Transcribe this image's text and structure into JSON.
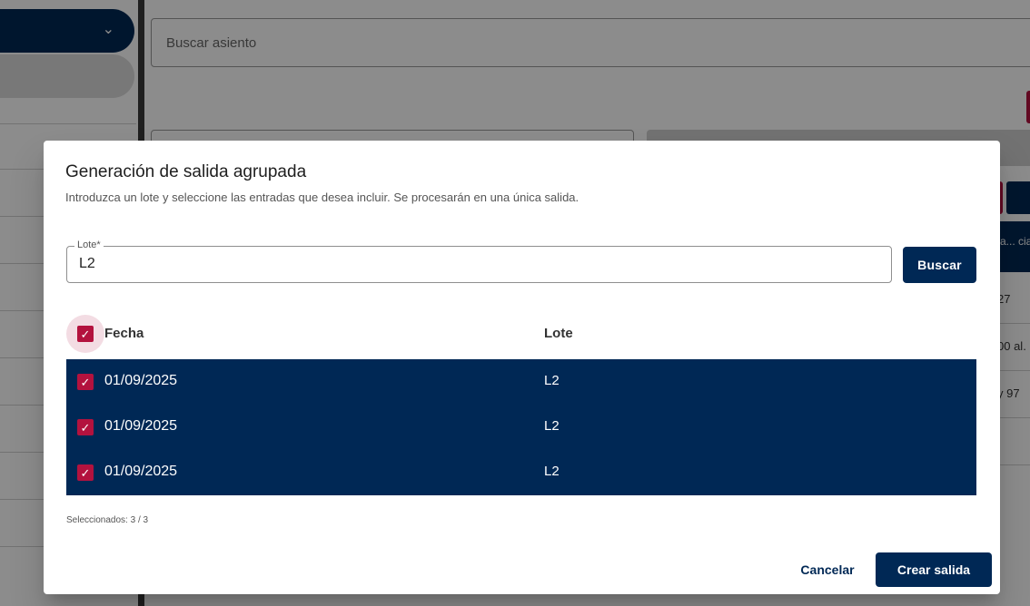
{
  "background": {
    "search_placeholder": "Buscar asiento",
    "table_header_partial": "a... cia",
    "cells_partial": [
      "27",
      "00 al.",
      "y 97"
    ]
  },
  "dialog": {
    "title": "Generación de salida agrupada",
    "subtitle": "Introduzca un lote y seleccione las entradas que desea incluir. Se procesarán en una única salida.",
    "lote_field": {
      "label": "Lote*",
      "value": "L2"
    },
    "search_button": "Buscar",
    "table": {
      "columns": [
        "Fecha",
        "Lote"
      ],
      "select_all_checked": true,
      "rows": [
        {
          "fecha": "01/09/2025",
          "lote": "L2",
          "checked": true
        },
        {
          "fecha": "01/09/2025",
          "lote": "L2",
          "checked": true
        },
        {
          "fecha": "01/09/2025",
          "lote": "L2",
          "checked": true
        }
      ]
    },
    "selected_counter": "Seleccionados: 3 / 3",
    "cancel_button": "Cancelar",
    "create_button": "Crear salida"
  },
  "colors": {
    "primary": "#002855",
    "accent": "#b3123e"
  }
}
